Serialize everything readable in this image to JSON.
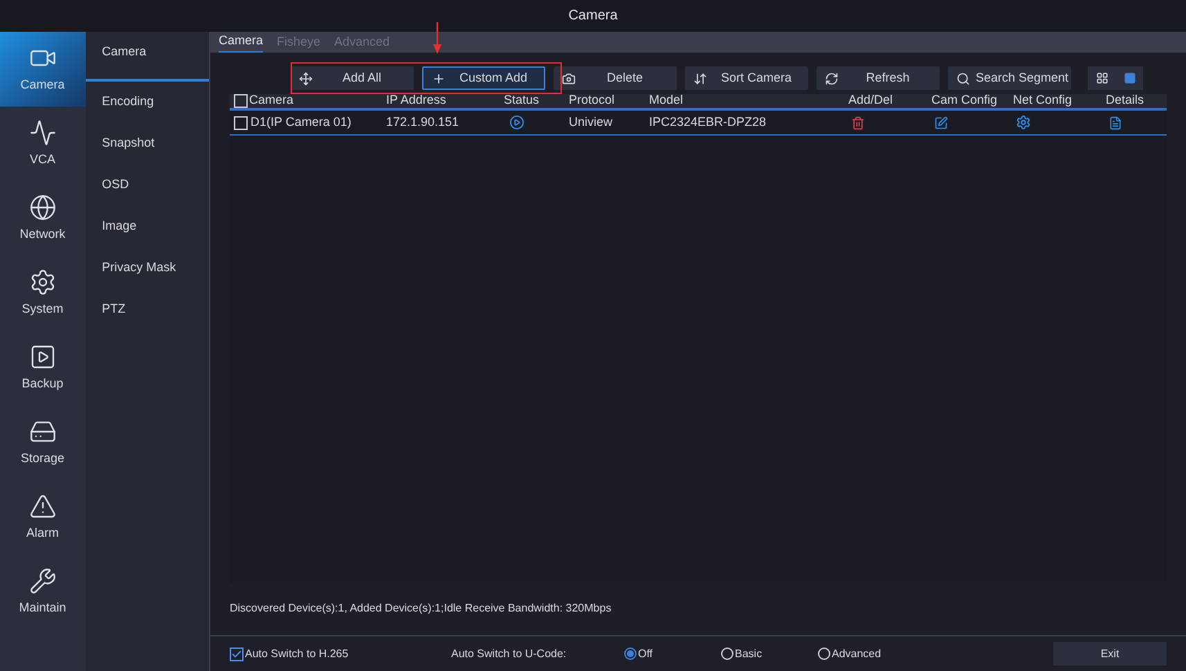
{
  "window": {
    "title": "Camera"
  },
  "nav": [
    {
      "label": "Camera",
      "kind": "camera",
      "selected": true
    },
    {
      "label": "VCA",
      "kind": "vca",
      "selected": false
    },
    {
      "label": "Network",
      "kind": "network",
      "selected": false
    },
    {
      "label": "System",
      "kind": "system",
      "selected": false
    },
    {
      "label": "Backup",
      "kind": "backup",
      "selected": false
    },
    {
      "label": "Storage",
      "kind": "storage",
      "selected": false
    },
    {
      "label": "Alarm",
      "kind": "alarm",
      "selected": false
    },
    {
      "label": "Maintain",
      "kind": "maintain",
      "selected": false
    }
  ],
  "submenu": [
    {
      "label": "Camera",
      "selected": true
    },
    {
      "label": "Encoding",
      "selected": false
    },
    {
      "label": "Snapshot",
      "selected": false
    },
    {
      "label": "OSD",
      "selected": false
    },
    {
      "label": "Image",
      "selected": false
    },
    {
      "label": "Privacy Mask",
      "selected": false
    },
    {
      "label": "PTZ",
      "selected": false
    }
  ],
  "tabs": [
    {
      "label": "Camera",
      "selected": true
    },
    {
      "label": "Fisheye",
      "selected": false
    },
    {
      "label": "Advanced",
      "selected": false
    }
  ],
  "toolbar": [
    {
      "label": "Add All",
      "kind": "move",
      "highlighted": false
    },
    {
      "label": "Custom Add",
      "kind": "plus",
      "highlighted": true
    },
    {
      "label": "Delete",
      "kind": "delete",
      "highlighted": false
    },
    {
      "label": "Sort Camera",
      "kind": "sort",
      "highlighted": false
    },
    {
      "label": "Refresh",
      "kind": "refresh",
      "highlighted": false
    },
    {
      "label": "Search Segment",
      "kind": "search",
      "highlighted": false
    }
  ],
  "view_modes": [
    {
      "kind": "grid",
      "selected": false
    },
    {
      "kind": "list",
      "selected": true
    }
  ],
  "table": {
    "header_checked": false,
    "columns": [
      "Camera",
      "IP Address",
      "Status",
      "Protocol",
      "Model",
      "Add/Del",
      "Cam Config",
      "Net Config",
      "Details"
    ],
    "rows": [
      {
        "camera": "D1(IP Camera 01)",
        "checked": false,
        "ip": "172.1.90.151",
        "protocol": "Uniview",
        "model": "IPC2324EBR-DPZ28"
      }
    ]
  },
  "status_text": "Discovered Device(s):1, Added Device(s):1;Idle Receive Bandwidth: 320Mbps",
  "auto_h265": {
    "label": "Auto Switch to H.265",
    "checked": true
  },
  "ucode": {
    "label": "Auto Switch to U-Code:",
    "options": [
      {
        "label": "Off",
        "selected": true
      },
      {
        "label": "Basic",
        "selected": false
      },
      {
        "label": "Advanced",
        "selected": false
      }
    ]
  },
  "exit_button": "Exit"
}
